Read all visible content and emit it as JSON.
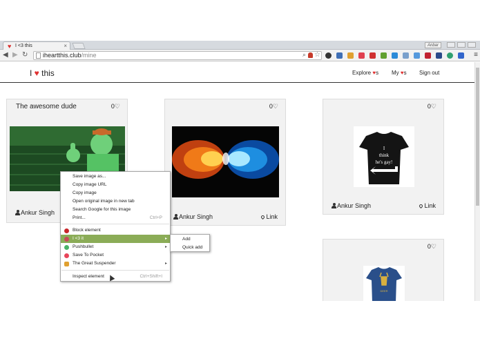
{
  "browser": {
    "tab_title": "I <3 this",
    "tab_close": "×",
    "url_host": "iheartthis.club",
    "url_path": "/mine",
    "user_badge": "Anbar"
  },
  "site": {
    "brand_pre": "I ",
    "brand_heart": "♥",
    "brand_post": " this",
    "nav": [
      {
        "pre": "Explore ",
        "heart": "♥",
        "post": "s"
      },
      {
        "pre": "My ",
        "heart": "♥",
        "post": "s"
      },
      {
        "pre": "Sign out",
        "heart": "",
        "post": ""
      }
    ]
  },
  "cards": [
    {
      "title": "The awesome dude",
      "likes": "0♡",
      "author": "Ankur Singh",
      "link": ""
    },
    {
      "title": "",
      "likes": "0♡",
      "author": "Ankur Singh",
      "link": "Link"
    },
    {
      "title": "",
      "likes": "0♡",
      "author": "Ankur Singh",
      "link": "Link"
    },
    {
      "title": "",
      "likes": "0♡",
      "author": "",
      "link": ""
    }
  ],
  "shirts": {
    "black_text": "I think he's gay!",
    "blue_text": "DEER"
  },
  "context_menu": {
    "items": [
      {
        "label": "Save image as...",
        "shortcut": ""
      },
      {
        "label": "Copy image URL",
        "shortcut": ""
      },
      {
        "label": "Copy image",
        "shortcut": ""
      },
      {
        "label": "Open original image in new tab",
        "shortcut": ""
      },
      {
        "label": "Search Google for this image",
        "shortcut": ""
      },
      {
        "label": "Print...",
        "shortcut": "Ctrl+P"
      },
      {
        "label": "Block element",
        "shortcut": ""
      },
      {
        "label": "I <3 it",
        "shortcut": ""
      },
      {
        "label": "Pushbullet",
        "shortcut": ""
      },
      {
        "label": "Save To Pocket",
        "shortcut": ""
      },
      {
        "label": "The Great Suspender",
        "shortcut": ""
      },
      {
        "label": "Inspect element",
        "shortcut": "Ctrl+Shift+I"
      }
    ],
    "submenu": [
      "Add",
      "Quick add"
    ],
    "arrow": "▸"
  },
  "colors": {
    "accent_heart": "#e03030",
    "menu_highlight": "#8bac57"
  }
}
